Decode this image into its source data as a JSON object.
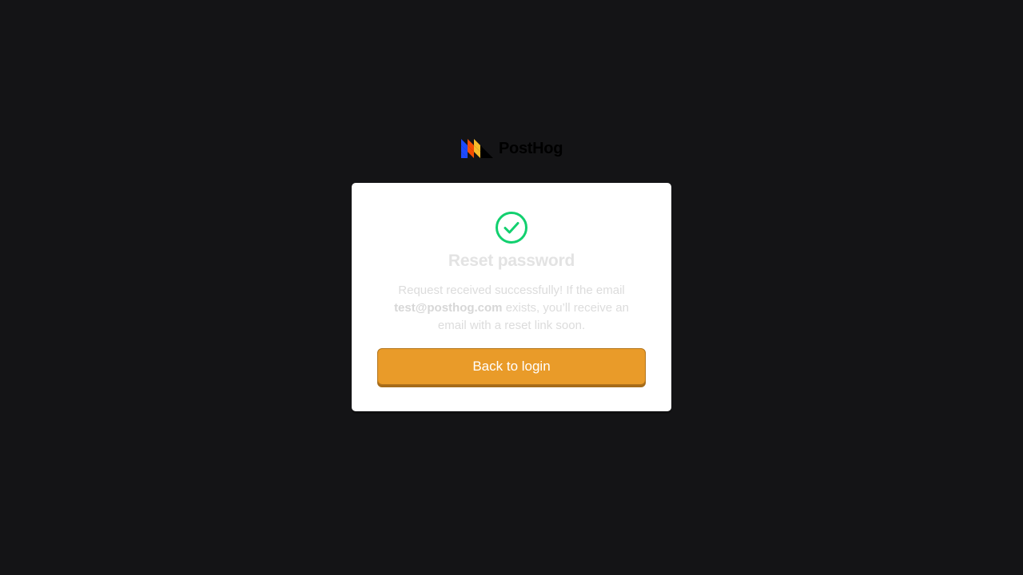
{
  "logo": {
    "wordmark": "PostHog",
    "icon_name": "posthog-hedgehog-logo-icon",
    "colors": [
      "#1d4aff",
      "#f54e00",
      "#f9bd2b",
      "#000000"
    ]
  },
  "card": {
    "icon_name": "check-circle-icon",
    "icon_color": "#12d06f",
    "title": "Reset password",
    "message_before": "Request received successfully! If the email ",
    "email": "test@posthog.com",
    "message_after": " exists, you’ll receive an email with a reset link soon.",
    "button_label": "Back to login",
    "button_color": "#e99b29"
  }
}
